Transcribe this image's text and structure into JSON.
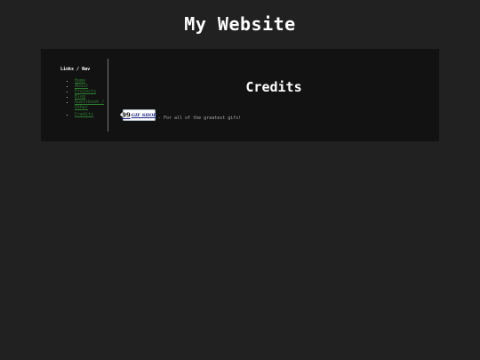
{
  "site": {
    "title": "My Website"
  },
  "sidebar": {
    "heading": "Links / Nav",
    "items": [
      {
        "label": "Home"
      },
      {
        "label": "About"
      },
      {
        "label": "Projects"
      },
      {
        "label": "Blog"
      },
      {
        "label": "Guestbook / Other"
      },
      {
        "label": "Credits"
      }
    ]
  },
  "content": {
    "title": "Credits",
    "credits": [
      {
        "badge_number": "99",
        "badge_label": "GIF SHOP",
        "text": "- For all of the greatest gifs!"
      }
    ]
  }
}
